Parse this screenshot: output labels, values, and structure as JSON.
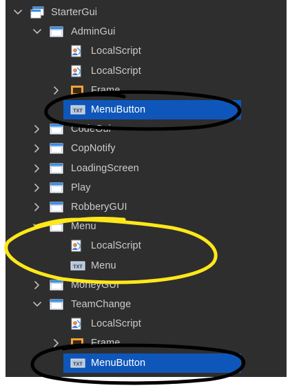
{
  "tree": [
    {
      "label": "StarterGui",
      "icon": "starter-gui-icon",
      "indent": 0,
      "chevron": "down"
    },
    {
      "label": "AdminGui",
      "icon": "screen-gui-icon",
      "indent": 1,
      "chevron": "down"
    },
    {
      "label": "LocalScript",
      "icon": "local-script-icon",
      "indent": 2,
      "chevron": "none"
    },
    {
      "label": "LocalScript",
      "icon": "local-script-icon",
      "indent": 2,
      "chevron": "none"
    },
    {
      "label": "Frame",
      "icon": "frame-icon",
      "indent": 2,
      "chevron": "right"
    },
    {
      "label": "MenuButton",
      "icon": "text-button-icon",
      "indent": 2,
      "chevron": "none",
      "selected": true
    },
    {
      "label": "CodeGui",
      "icon": "screen-gui-icon",
      "indent": 1,
      "chevron": "right"
    },
    {
      "label": "CopNotify",
      "icon": "screen-gui-icon",
      "indent": 1,
      "chevron": "right"
    },
    {
      "label": "LoadingScreen",
      "icon": "screen-gui-icon",
      "indent": 1,
      "chevron": "right"
    },
    {
      "label": "Play",
      "icon": "screen-gui-icon",
      "indent": 1,
      "chevron": "right"
    },
    {
      "label": "RobberyGUI",
      "icon": "screen-gui-icon",
      "indent": 1,
      "chevron": "right"
    },
    {
      "label": "Menu",
      "icon": "screen-gui-icon",
      "indent": 1,
      "chevron": "down"
    },
    {
      "label": "LocalScript",
      "icon": "local-script-icon",
      "indent": 2,
      "chevron": "none"
    },
    {
      "label": "Menu",
      "icon": "text-button-icon",
      "indent": 2,
      "chevron": "none"
    },
    {
      "label": "MoneyGUI",
      "icon": "screen-gui-icon",
      "indent": 1,
      "chevron": "right"
    },
    {
      "label": "TeamChange",
      "icon": "screen-gui-icon",
      "indent": 1,
      "chevron": "down"
    },
    {
      "label": "LocalScript",
      "icon": "local-script-icon",
      "indent": 2,
      "chevron": "none"
    },
    {
      "label": "Frame",
      "icon": "frame-icon",
      "indent": 2,
      "chevron": "right"
    },
    {
      "label": "MenuButton",
      "icon": "text-button-icon",
      "indent": 2,
      "chevron": "none",
      "selected": true
    }
  ],
  "colors": {
    "panel_bg": "#2e2e2e",
    "text": "#cccccc",
    "selection": "#0f56ba",
    "annotation_black": "#000000",
    "annotation_yellow": "#ffe81a"
  },
  "icon_texts": {
    "text_button": "TXT"
  }
}
